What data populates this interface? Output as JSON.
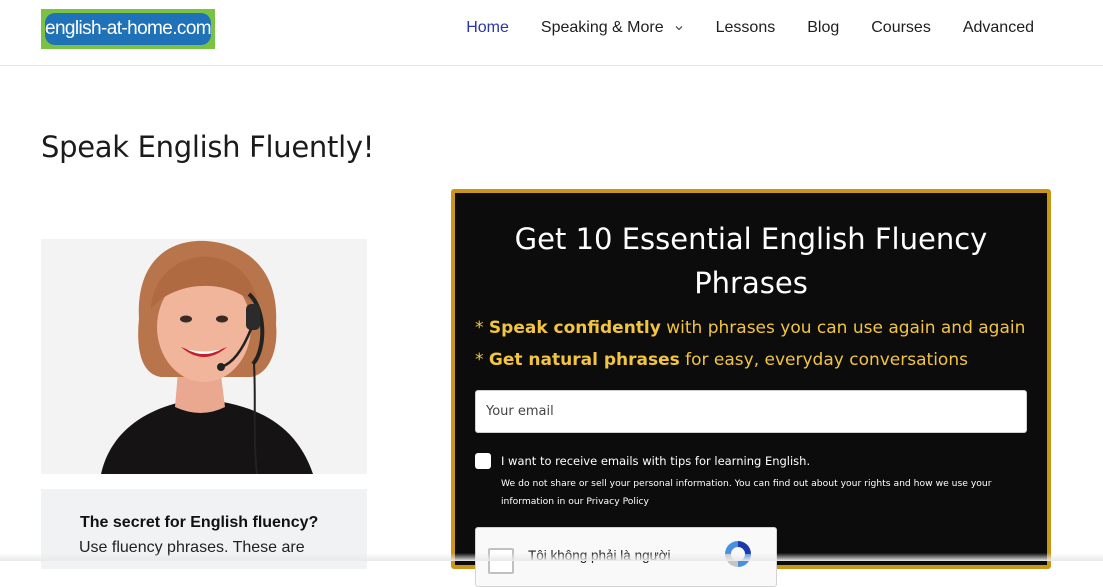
{
  "header": {
    "logo_text": "english-at-home.com",
    "nav": [
      {
        "label": "Home",
        "active": true
      },
      {
        "label": "Speaking & More",
        "has_dropdown": true
      },
      {
        "label": "Lessons"
      },
      {
        "label": "Blog"
      },
      {
        "label": "Courses"
      },
      {
        "label": "Advanced"
      }
    ]
  },
  "main": {
    "title": "Speak English Fluently!",
    "sidebar": {
      "photo_icon": "woman-with-headset-photo",
      "heading": "The secret for English fluency?",
      "text": "Use fluency phrases. These are"
    }
  },
  "optin": {
    "title": "Get 10 Essential English Fluency Phrases",
    "bullets": [
      {
        "prefix": "* ",
        "bold": "Speak confidently",
        "rest": " with phrases you can use again and again"
      },
      {
        "prefix": "* ",
        "bold": "Get natural phrases",
        "rest": " for easy, everyday conversations"
      }
    ],
    "email_placeholder": "Your email",
    "consent_label": "I want to receive emails with tips for learning English.",
    "consent_note": "We do not share or sell your personal information. You can find out about your rights and how we use your information in our Privacy Policy",
    "captcha_label": "Tôi không phải là người",
    "colors": {
      "border": "#c9961a",
      "background": "#0c0c0c",
      "accent": "#f2c53d"
    }
  }
}
